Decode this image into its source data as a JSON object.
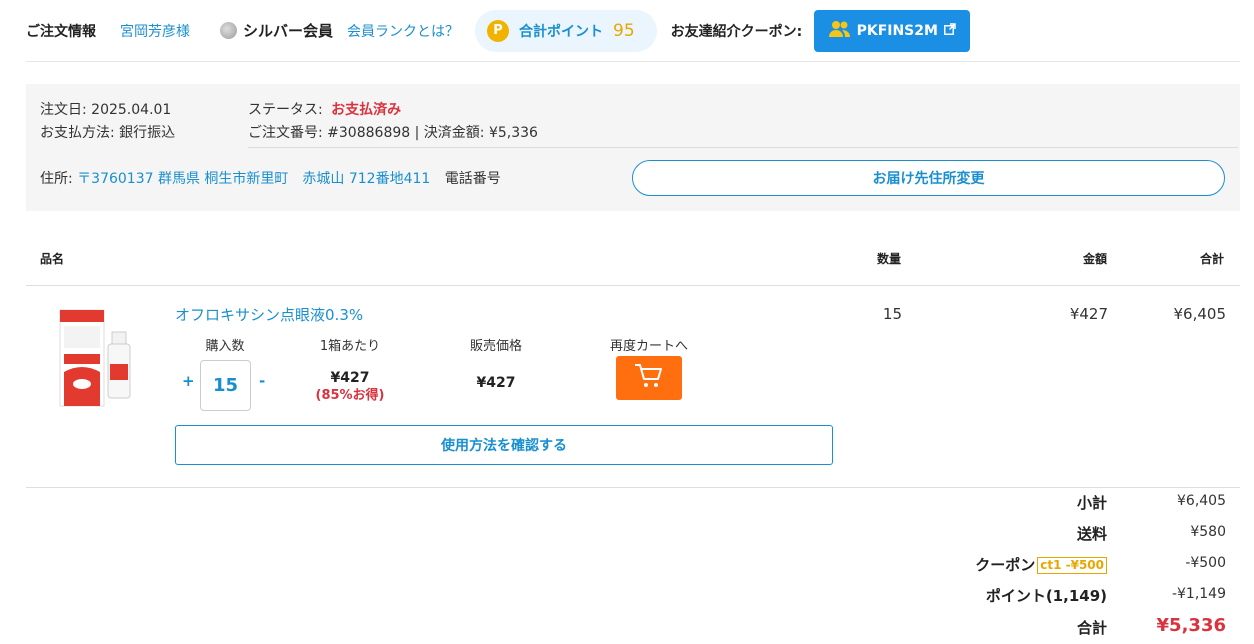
{
  "header": {
    "title": "ご注文情報",
    "customer_name": "宮岡芳彦様",
    "rank_label": "シルバー会員",
    "rank_link": "会員ランクとは？",
    "points_icon": "P",
    "points_label": "合計ポイント",
    "points_value": "95",
    "coupon_label": "お友達紹介クーポン:",
    "coupon_code": "PKFINS2M"
  },
  "order": {
    "date_label": "注文日:",
    "date": "2025.04.01",
    "status_label": "ステータス:",
    "status": "お支払済み",
    "payment_label": "お支払方法:",
    "payment_method": "銀行振込",
    "order_no_label": "ご注文番号:",
    "order_no": "#30886898",
    "separator": "|",
    "settled_label": "決済金額:",
    "settled_amount": "¥5,336",
    "address_label": "住所:",
    "address": "〒3760137 群馬県 桐生市新里町　赤城山 712番地411",
    "phone_label": "電話番号",
    "change_address_label": "お届け先住所変更"
  },
  "table": {
    "headers": {
      "name": "品名",
      "qty": "数量",
      "price": "金額",
      "total": "合計"
    }
  },
  "product": {
    "name": "オフロキサシン点眼液0.3%",
    "col_qty_label": "購入数",
    "col_unit_label": "1箱あたり",
    "col_sale_label": "販売価格",
    "col_cart_label": "再度カートへ",
    "plus": "+",
    "minus": "-",
    "qty_input": "15",
    "unit_price": "¥427",
    "unit_discount": "(85%お得)",
    "sale_price": "¥427",
    "usage_button": "使用方法を確認する",
    "qty": "15",
    "price": "¥427",
    "line_total": "¥6,405"
  },
  "summary": {
    "subtotal_label": "小計",
    "subtotal": "¥6,405",
    "shipping_label": "送料",
    "shipping": "¥580",
    "coupon_label": "クーポン",
    "coupon_tag": "ct1 -¥500",
    "coupon": "-¥500",
    "points_label": "ポイント(1,149)",
    "points": "-¥1,149",
    "total_label": "合計",
    "total": "¥5,336"
  },
  "colors": {
    "accent": "#1a8fd0",
    "status_red": "#d9333f",
    "cart_orange": "#ff6f0f",
    "points_gold": "#e8a700"
  },
  "icons": [
    "silver-rank-icon",
    "points-icon",
    "users-icon",
    "external-link-icon",
    "cart-icon",
    "product-image"
  ]
}
